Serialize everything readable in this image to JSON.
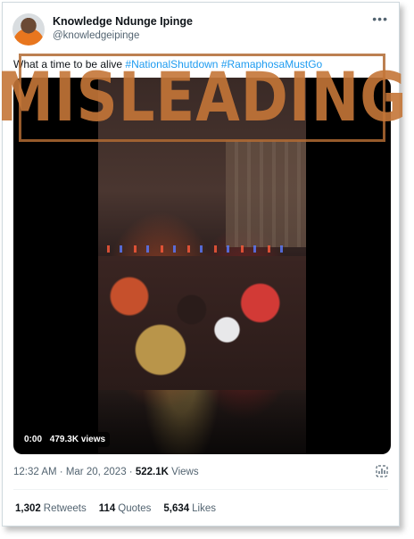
{
  "author": {
    "name": "Knowledge Ndunge Ipinge",
    "handle": "@knowledgeipinge"
  },
  "tweet": {
    "text": "What a time to be alive",
    "hashtags": [
      "#NationalShutdown",
      "#RamaphosaMustGo"
    ]
  },
  "stamp": {
    "label": "MISLEADING",
    "color": "#c47637"
  },
  "video": {
    "time": "0:00",
    "views": "479.3K views"
  },
  "meta": {
    "time": "12:32 AM",
    "separator": " · ",
    "date": "Mar 20, 2023",
    "views_count": "522.1K",
    "views_label": "Views"
  },
  "stats": {
    "retweets_count": "1,302",
    "retweets_label": "Retweets",
    "quotes_count": "114",
    "quotes_label": "Quotes",
    "likes_count": "5,634",
    "likes_label": "Likes"
  },
  "icons": {
    "more": "more-options-icon",
    "analytics": "analytics-icon"
  },
  "colors": {
    "link": "#1d9bf0",
    "secondary_text": "#536471",
    "border": "#cfd9de"
  }
}
